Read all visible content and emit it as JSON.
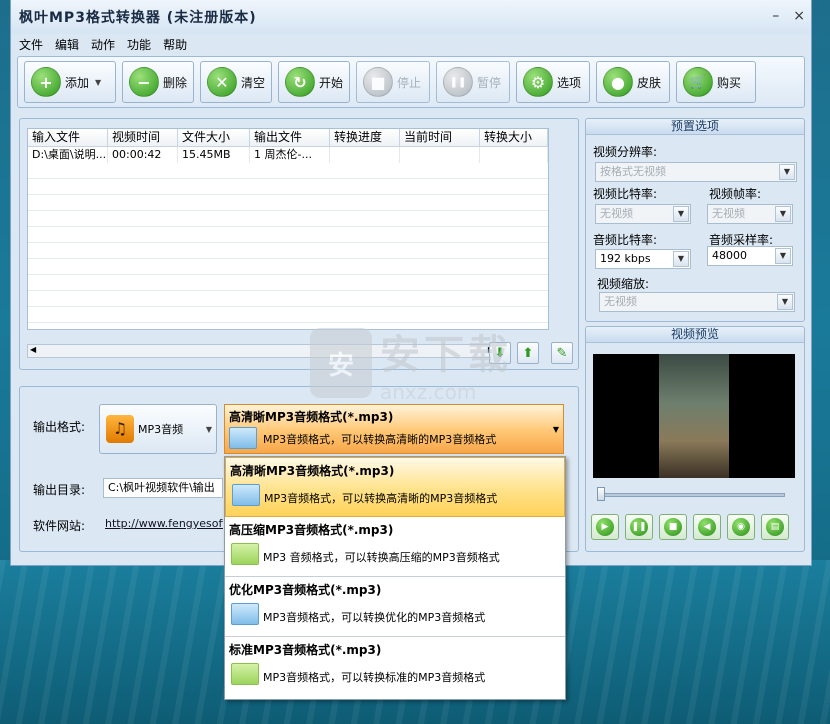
{
  "window": {
    "title": "枫叶MP3格式转换器   (未注册版本)",
    "min": "–",
    "close": "×"
  },
  "menu": [
    "文件",
    "编辑",
    "动作",
    "功能",
    "帮助"
  ],
  "toolbar": [
    {
      "label": "添加",
      "icon": "plus-icon",
      "glyph": "+",
      "enabled": true,
      "dropdown": true
    },
    {
      "label": "删除",
      "icon": "minus-icon",
      "glyph": "−",
      "enabled": true
    },
    {
      "label": "清空",
      "icon": "clear-icon",
      "glyph": "✕",
      "enabled": true
    },
    {
      "label": "开始",
      "icon": "refresh-icon",
      "glyph": "↻",
      "enabled": true
    },
    {
      "label": "停止",
      "icon": "stop-icon",
      "glyph": "■",
      "enabled": false
    },
    {
      "label": "暂停",
      "icon": "pause-icon",
      "glyph": "❚❚",
      "enabled": false
    },
    {
      "label": "选项",
      "icon": "options-icon",
      "glyph": "⚙",
      "enabled": true
    },
    {
      "label": "皮肤",
      "icon": "apple-icon",
      "glyph": "●",
      "enabled": true
    },
    {
      "label": "购买",
      "icon": "cart-icon",
      "glyph": "🛒",
      "enabled": true
    }
  ],
  "file_list": {
    "columns": [
      "输入文件",
      "视频时间",
      "文件大小",
      "输出文件",
      "转换进度",
      "当前时间",
      "转换大小"
    ],
    "rows": [
      [
        "D:\\桌面\\说明...",
        "00:00:42",
        "15.45MB",
        "1 周杰伦-...",
        "",
        "",
        ""
      ]
    ]
  },
  "output": {
    "format_label": "输出格式:",
    "format_button": "MP3音频",
    "selected_title": "高清晰MP3音频格式(*.mp3)",
    "selected_desc": "MP3音频格式，可以转换高清晰的MP3音频格式",
    "dir_label": "输出目录:",
    "dir_value": "C:\\枫叶视频软件\\输出",
    "site_label": "软件网站:",
    "site_value": "http://www.fengyesoft.c"
  },
  "dropdown_items": [
    {
      "title": "高清晰MP3音频格式(*.mp3)",
      "desc": "MP3音频格式，可以转换高清晰的MP3音频格式",
      "selected": true
    },
    {
      "title": "高压缩MP3音频格式(*.mp3)",
      "desc": "MP3 音频格式，可以转换高压缩的MP3音频格式",
      "selected": false
    },
    {
      "title": "优化MP3音频格式(*.mp3)",
      "desc": "MP3音频格式，可以转换优化的MP3音频格式",
      "selected": false
    },
    {
      "title": "标准MP3音频格式(*.mp3)",
      "desc": "MP3音频格式，可以转换标准的MP3音频格式",
      "selected": false
    }
  ],
  "preset": {
    "title": "预置选项",
    "res_label": "视频分辨率:",
    "res_value": "按格式无视频",
    "vbit_label": "视频比特率:",
    "vbit_value": "无视频",
    "fps_label": "视频帧率:",
    "fps_value": "无视频",
    "abit_label": "音频比特率:",
    "abit_value": "192 kbps",
    "arate_label": "音频采样率:",
    "arate_value": "48000",
    "zoom_label": "视频缩放:",
    "zoom_value": "无视频"
  },
  "preview": {
    "title": "视频预览"
  },
  "watermark": {
    "big": "安下载",
    "small": "anxz.com",
    "shield": "安"
  },
  "accent": {
    "selection": "#ffc774",
    "green": "#2f9a1f"
  }
}
